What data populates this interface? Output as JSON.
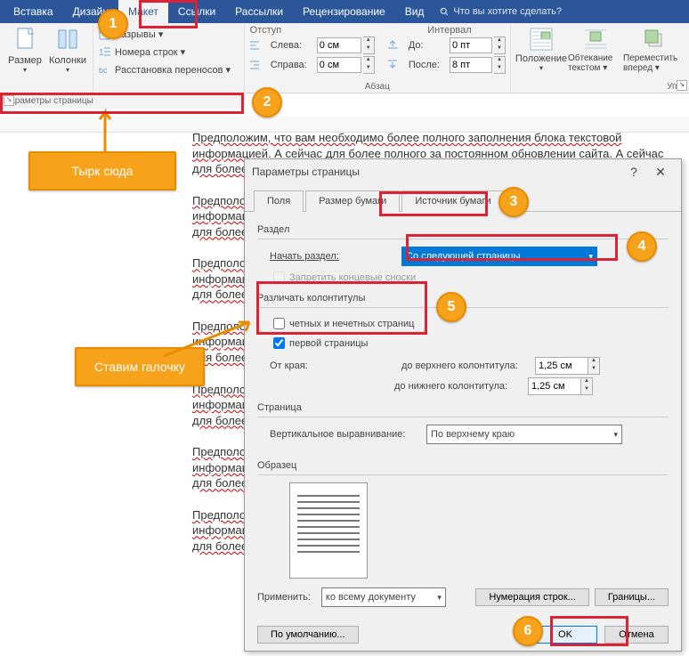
{
  "ribbon": {
    "tabs": [
      "Вставка",
      "Дизайн",
      "Макет",
      "Ссылки",
      "Рассылки",
      "Рецензирование",
      "Вид"
    ],
    "active_tab": 2,
    "tellme": "Что вы хотите сделать?",
    "size_btn": "Размер",
    "columns_btn": "Колонки",
    "breaks": "Разрывы ▾",
    "line_numbers": "Номера строк ▾",
    "hyphenation": "Расстановка переносов ▾",
    "indent_label": "Отступ",
    "interval_label": "Интервал",
    "left": "Слева:",
    "right": "Справа:",
    "before": "До:",
    "after": "После:",
    "left_val": "0 см",
    "right_val": "0 см",
    "before_val": "0 пт",
    "after_val": "8 пт",
    "page_setup": "Параметры страницы",
    "paragraph": "Абзац",
    "ordering": "Упо",
    "position": "Положение",
    "wrap": "Обтекание текстом ▾",
    "forward": "Переместить вперед ▾"
  },
  "dialog": {
    "title": "Параметры страницы",
    "tab1": "Поля",
    "tab2": "Размер бумаги",
    "tab3": "Источник бумаги",
    "section": "Раздел",
    "start_section": "Начать раздел:",
    "start_section_val": "Со следующей страницы",
    "suppress_endnotes": "Запретить концевые сноски",
    "headers_footers": "Различать колонтитулы",
    "odd_even": "четных и нечетных страниц",
    "first_page": "первой страницы",
    "from_edge": "От края:",
    "to_header": "до верхнего колонтитула:",
    "to_footer": "до нижнего колонтитула:",
    "header_val": "1,25 см",
    "footer_val": "1,25 см",
    "page": "Страница",
    "valign": "Вертикальное выравнивание:",
    "valign_val": "По верхнему краю",
    "sample": "Образец",
    "apply_to": "Применить:",
    "apply_to_val": "ко всему документу",
    "line_numbers_btn": "Нумерация строк...",
    "borders_btn": "Границы...",
    "default_btn": "По умолчанию...",
    "ok": "OK",
    "cancel": "Отмена"
  },
  "callouts": {
    "c1": "Тырк сюда",
    "c2": "Ставим галочку"
  },
  "bg_text": "Предположим, что вам необходимо более полного заполнения блока текстовой информацией. А сейчас для более полного за постоянном обновлении сайта. А сейчас для более полного за будет выглядеть",
  "badges": {
    "b1": "1",
    "b2": "2",
    "b3": "3",
    "b4": "4",
    "b5": "5",
    "b6": "6"
  }
}
